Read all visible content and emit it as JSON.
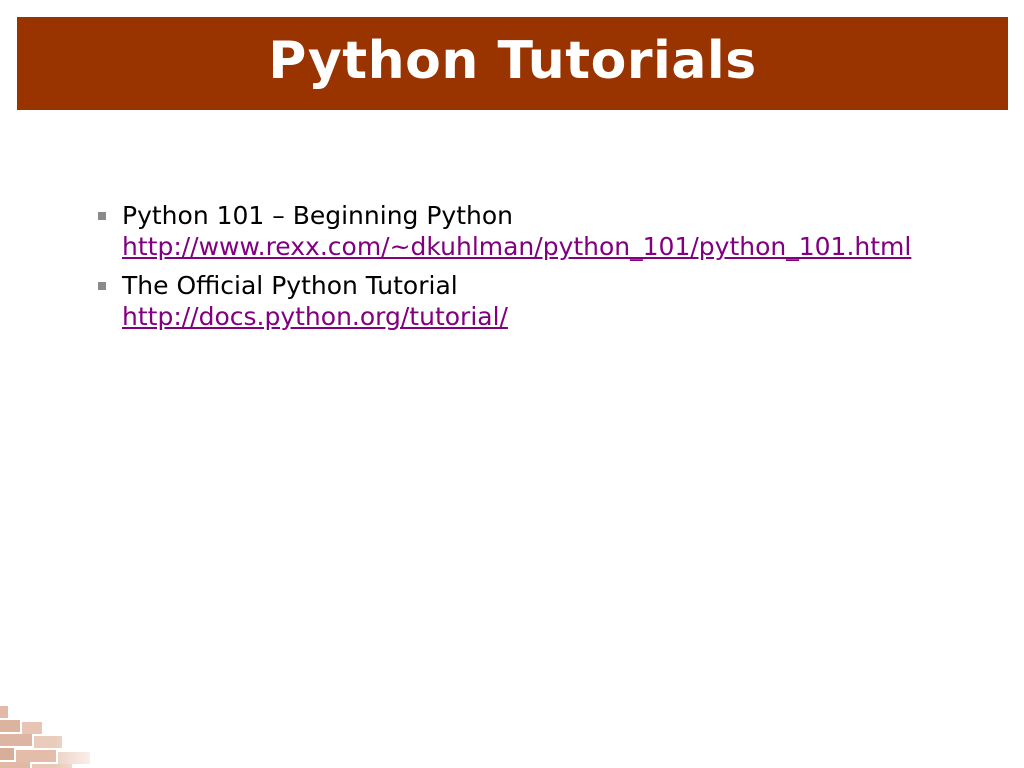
{
  "slide": {
    "title": "Python Tutorials",
    "accent_color": "#993300",
    "link_color": "#800080",
    "bullets": [
      {
        "label": "Python 101 – Beginning Python",
        "link": "http://www.rexx.com/~dkuhlman/python_101/python_101.html"
      },
      {
        "label": "The Official Python Tutorial",
        "link": "http://docs.python.org/tutorial/"
      }
    ]
  }
}
